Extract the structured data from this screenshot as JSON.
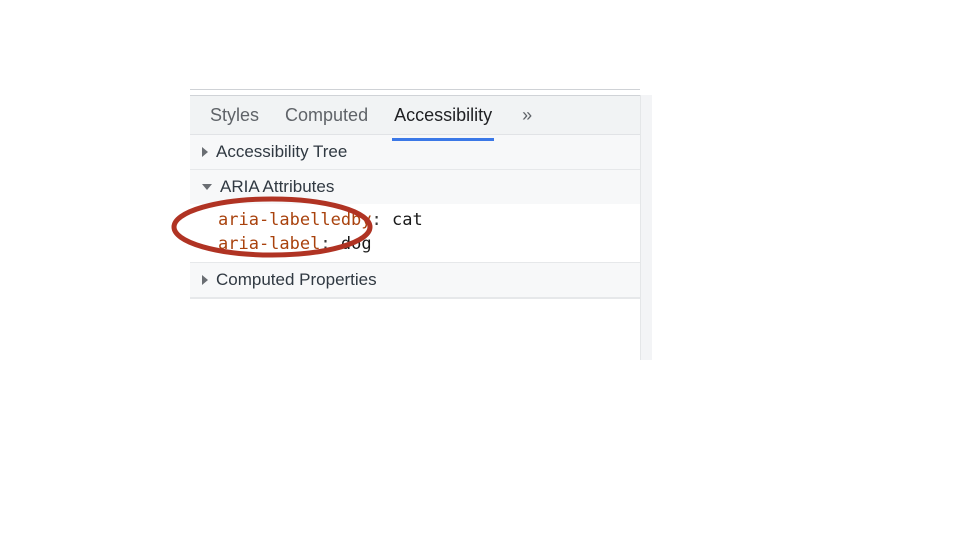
{
  "tabs": {
    "styles": "Styles",
    "computed": "Computed",
    "accessibility": "Accessibility",
    "overflow_glyph": "»"
  },
  "sections": {
    "tree": {
      "title": "Accessibility Tree"
    },
    "aria": {
      "title": "ARIA Attributes",
      "attrs": [
        {
          "key": "aria-labelledby",
          "value": "cat"
        },
        {
          "key": "aria-label",
          "value": "dog"
        }
      ]
    },
    "computed_props": {
      "title": "Computed Properties"
    }
  }
}
